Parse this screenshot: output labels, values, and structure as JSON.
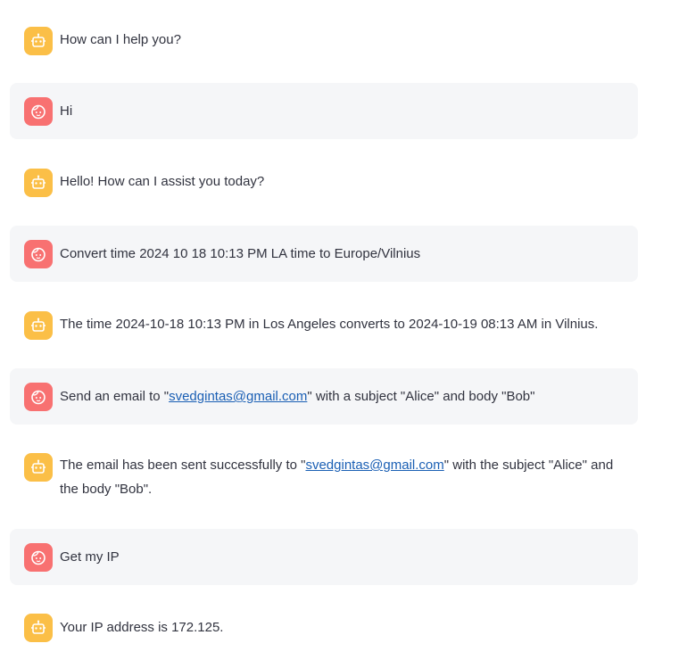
{
  "messages": [
    {
      "role": "assistant",
      "avatar_icon": "robot-icon",
      "text": "How can I help you?"
    },
    {
      "role": "user",
      "avatar_icon": "user-face-icon",
      "text": "Hi"
    },
    {
      "role": "assistant",
      "avatar_icon": "robot-icon",
      "text": "Hello! How can I assist you today?"
    },
    {
      "role": "user",
      "avatar_icon": "user-face-icon",
      "text": "Convert time 2024 10 18 10:13 PM LA time to Europe/Vilnius"
    },
    {
      "role": "assistant",
      "avatar_icon": "robot-icon",
      "text": "The time 2024-10-18 10:13 PM in Los Angeles converts to 2024-10-19 08:13 AM in Vilnius."
    },
    {
      "role": "user",
      "avatar_icon": "user-face-icon",
      "text_before": "Send an email to \"",
      "link": "svedgintas@gmail.com",
      "text_after": "\" with a subject \"Alice\" and body \"Bob\""
    },
    {
      "role": "assistant",
      "avatar_icon": "robot-icon",
      "text_before": "The email has been sent successfully to \"",
      "link": "svedgintas@gmail.com",
      "text_after": "\" with the subject \"Alice\" and the body \"Bob\"."
    },
    {
      "role": "user",
      "avatar_icon": "user-face-icon",
      "text": "Get my IP"
    },
    {
      "role": "assistant",
      "avatar_icon": "robot-icon",
      "text": "Your IP address is 172.125."
    }
  ],
  "colors": {
    "assistant_avatar": "#fbbf47",
    "user_avatar": "#f87171",
    "user_bubble": "#f5f6f8",
    "link": "#1a5fb4",
    "text": "#31333f"
  }
}
